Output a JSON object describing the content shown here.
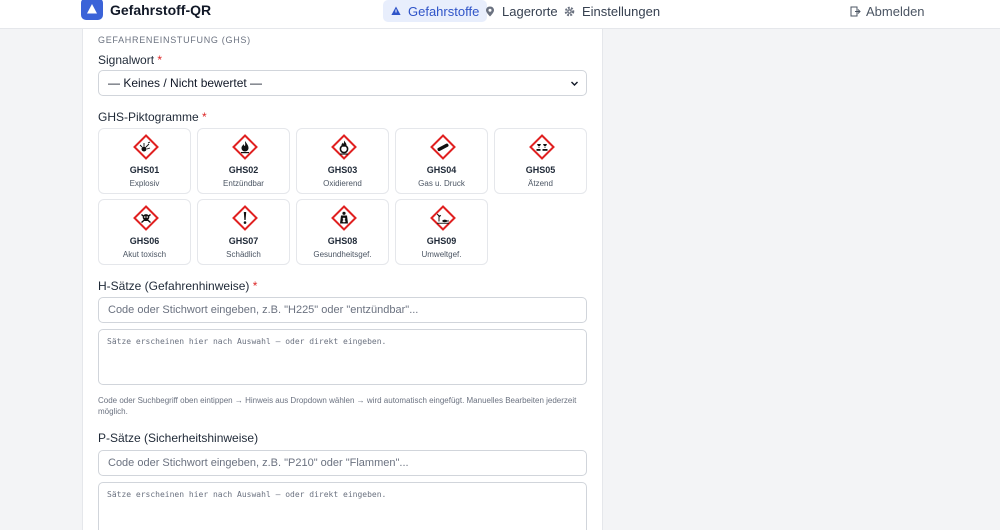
{
  "header": {
    "brand": "Gefahrstoff-QR",
    "tabs": [
      {
        "label": "Gefahrstoffe",
        "icon": "warning-icon",
        "active": true
      },
      {
        "label": "Lagerorte",
        "icon": "location-pin-icon",
        "active": false
      },
      {
        "label": "Einstellungen",
        "icon": "gear-icon",
        "active": false
      }
    ],
    "logout": "Abmelden"
  },
  "form": {
    "section_title": "GEFAHRENEINSTUFUNG (GHS)",
    "signalwort": {
      "label": "Signalwort",
      "required": "*",
      "value": "— Keines / Nicht bewertet —"
    },
    "pictograms": {
      "label": "GHS-Piktogramme",
      "required": "*",
      "items": [
        {
          "code": "GHS01",
          "desc": "Explosiv",
          "icon": "explosive-icon"
        },
        {
          "code": "GHS02",
          "desc": "Entzündbar",
          "icon": "flame-icon"
        },
        {
          "code": "GHS03",
          "desc": "Oxidierend",
          "icon": "flame-over-circle-icon"
        },
        {
          "code": "GHS04",
          "desc": "Gas u. Druck",
          "icon": "gas-cylinder-icon"
        },
        {
          "code": "GHS05",
          "desc": "Ätzend",
          "icon": "corrosion-icon"
        },
        {
          "code": "GHS06",
          "desc": "Akut toxisch",
          "icon": "skull-icon"
        },
        {
          "code": "GHS07",
          "desc": "Schädlich",
          "icon": "exclamation-icon"
        },
        {
          "code": "GHS08",
          "desc": "Gesundheitsgef.",
          "icon": "health-hazard-icon"
        },
        {
          "code": "GHS09",
          "desc": "Umweltgef.",
          "icon": "environment-icon"
        }
      ]
    },
    "h_saetze": {
      "label": "H-Sätze (Gefahrenhinweise)",
      "required": "*",
      "search_placeholder": "Code oder Stichwort eingeben, z.B. \"H225\" oder \"entzündbar\"...",
      "textarea_placeholder": "Sätze erscheinen hier nach Auswahl — oder direkt eingeben.",
      "hint": "Code oder Suchbegriff oben eintippen → Hinweis aus Dropdown wählen → wird automatisch eingefügt. Manuelles Bearbeiten jederzeit möglich."
    },
    "p_saetze": {
      "label": "P-Sätze (Sicherheitshinweise)",
      "search_placeholder": "Code oder Stichwort eingeben, z.B. \"P210\" oder \"Flammen\"...",
      "textarea_placeholder": "Sätze erscheinen hier nach Auswahl — oder direkt eingeben."
    }
  },
  "colors": {
    "accent": "#3b63d8",
    "ghs_red": "#e02020",
    "required": "#dc2626"
  }
}
